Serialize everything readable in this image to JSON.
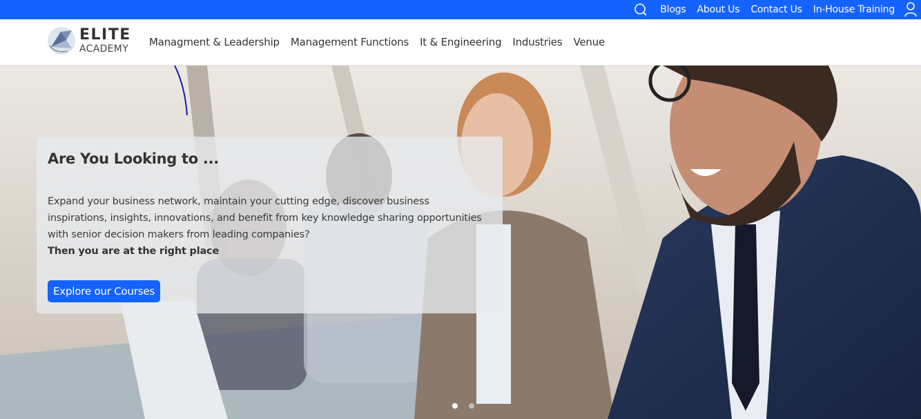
{
  "topbar": {
    "links": [
      "Blogs",
      "About Us",
      "Contact Us",
      "In-House Training"
    ],
    "search_icon": "search-icon",
    "user_icon": "user-icon",
    "bg_color": "#1563ff"
  },
  "logo": {
    "line1": "ELITE",
    "line2": "ACADEMY"
  },
  "nav": {
    "items": [
      "Managment & Leadership",
      "Management Functions",
      "It & Engineering",
      "Industries",
      "Venue"
    ]
  },
  "hero": {
    "title": "Are You Looking to ...",
    "body": "Expand your business network, maintain your cutting edge, discover business inspirations, insights, innovations, and benefit from key knowledge sharing opportunities with senior decision makers from leading companies?",
    "emphasis": "Then you are at the right place",
    "cta_label": "Explore our Courses",
    "cta_color": "#1563ff",
    "carousel_active_index": 0,
    "carousel_count": 2
  }
}
